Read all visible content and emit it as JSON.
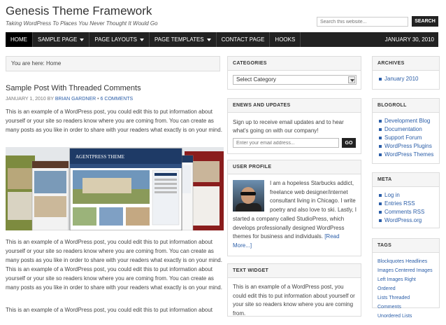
{
  "site": {
    "title": "Genesis Theme Framework",
    "description": "Taking WordPress To Places You Never Thought It Would Go",
    "search_placeholder": "Search this website...",
    "search_button": "SEARCH"
  },
  "nav": {
    "items": [
      {
        "label": "HOME",
        "dropdown": false
      },
      {
        "label": "SAMPLE PAGE",
        "dropdown": true
      },
      {
        "label": "PAGE LAYOUTS",
        "dropdown": true
      },
      {
        "label": "PAGE TEMPLATES",
        "dropdown": true
      },
      {
        "label": "CONTACT PAGE",
        "dropdown": false
      },
      {
        "label": "HOOKS",
        "dropdown": false
      }
    ],
    "date": "JANUARY 30, 2010"
  },
  "breadcrumb": "You are here: Home",
  "post": {
    "title": "Sample Post With Threaded Comments",
    "date": "JANUARY 1, 2010 BY",
    "author": "BRIAN GARDNER",
    "separator": "•",
    "comments": "6 COMMENTS",
    "para1": "This is an example of a WordPress post, you could edit this to put information about yourself or your site so readers know where you are coming from. You can create as many posts as you like in order to share with your readers what exactly is on your mind.",
    "image_caption": "AGENTPRESS THEME",
    "para2": "This is an example of a WordPress post, you could edit this to put information about yourself or your site so readers know where you are coming from. You can create as many posts as you like in order to share with your readers what exactly is on your mind. This is an example of a WordPress post, you could edit this to put information about yourself or your site so readers know where you are coming from. You can create as many posts as you like in order to share with your readers what exactly is on your mind.",
    "para3": "This is an example of a WordPress post, you could edit this to put information about"
  },
  "widgets": {
    "categories": {
      "title": "CATEGORIES",
      "select": "Select Category"
    },
    "enews": {
      "title": "ENEWS AND UPDATES",
      "text": "Sign up to receive email updates and to hear what's going on with our company!",
      "placeholder": "Enter your email address...",
      "button": "GO"
    },
    "profile": {
      "title": "USER PROFILE",
      "text1": "I am a hopeless Starbucks addict, freelance web designer/internet consultant living in Chicago. I write poetry and also love to ski. Lastly, I",
      "text2": "started a company called StudioPress, which develops professionally designed WordPress themes for business and individuals.",
      "read_more": "[Read More...]"
    },
    "text_widget": {
      "title": "TEXT WIDGET",
      "text": "This is an example of a WordPress post, you could edit this to put information about yourself or your site so readers know where you are coming from."
    },
    "archives": {
      "title": "ARCHIVES",
      "items": [
        "January 2010"
      ]
    },
    "blogroll": {
      "title": "BLOGROLL",
      "items": [
        "Development Blog",
        "Documentation",
        "Support Forum",
        "WordPress Plugins",
        "WordPress Themes"
      ]
    },
    "meta": {
      "title": "META",
      "items": [
        "Log in",
        "Entries RSS",
        "Comments RSS",
        "WordPress.org"
      ]
    },
    "tags": {
      "title": "TAGS",
      "items": [
        "Blockquotes Headlines",
        "Images Centered Images",
        "Left Images Right Ordered",
        "Lists Threaded Comments",
        "Unordered Lists"
      ]
    }
  },
  "colors": {
    "link": "#2b5ea8",
    "nav_bg": "#222222",
    "widget_title_bg": "#f5f5f5"
  }
}
